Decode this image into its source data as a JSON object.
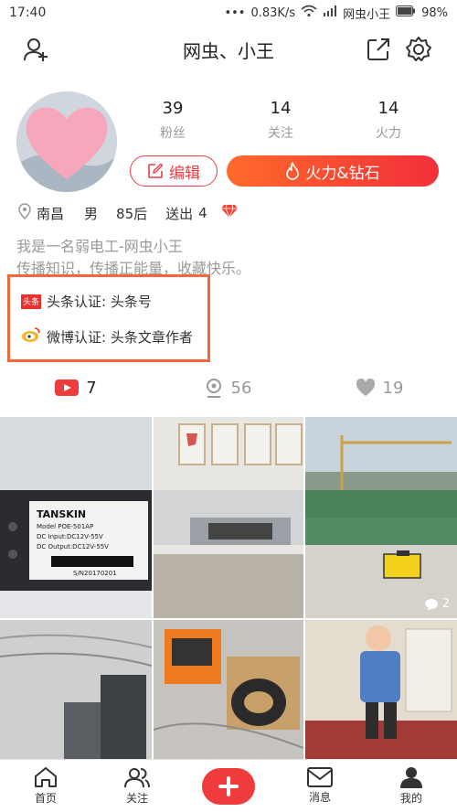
{
  "status": {
    "time": "17:40",
    "speed": "0.83K/s",
    "carrier": "网虫小王",
    "battery": "98%"
  },
  "header": {
    "title": "网虫、小王"
  },
  "profile": {
    "stats": [
      {
        "num": "39",
        "label": "粉丝"
      },
      {
        "num": "14",
        "label": "关注"
      },
      {
        "num": "14",
        "label": "火力"
      }
    ],
    "edit_label": "编辑",
    "fire_label": "火力&钻石",
    "location": "南昌",
    "gender": "男",
    "age": "85后",
    "sent_label": "送出",
    "sent_count": "4",
    "bio_line1": "我是一名弱电工-网虫小王",
    "bio_line2": "传播知识，传播正能量，收藏快乐。",
    "toutiao_badge": "头条",
    "verify_toutiao": "头条认证: 头条号",
    "verify_weibo": "微博认证: 头条文章作者"
  },
  "tabs": [
    {
      "count": "7"
    },
    {
      "count": "56"
    },
    {
      "count": "19"
    }
  ],
  "grid": {
    "tile1_brand": "TANSKIN",
    "tile1_model": "Model POE-501AP",
    "tile1_input": "DC Input:DC12V-55V",
    "tile1_output": "DC Output:DC12V-55V",
    "tile1_sn": "S/N20170201",
    "tile3_comments": "2"
  },
  "nav": [
    {
      "label": "首页"
    },
    {
      "label": "关注"
    },
    {
      "label": ""
    },
    {
      "label": "消息"
    },
    {
      "label": "我的"
    }
  ],
  "colors": {
    "accent": "#e83e45",
    "verify_border": "#f2683a"
  }
}
